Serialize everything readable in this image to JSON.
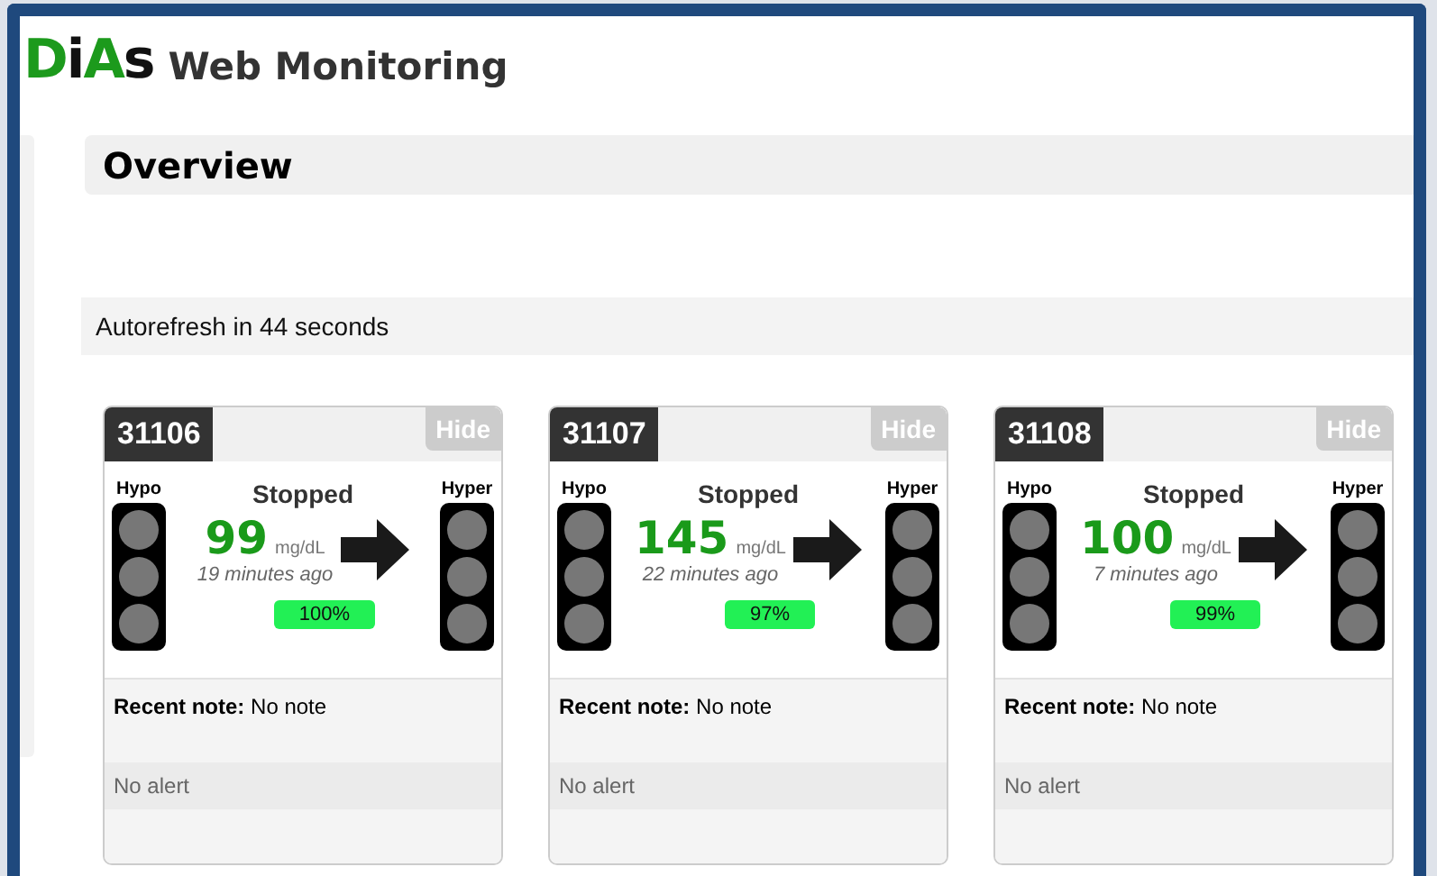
{
  "logo": [
    {
      "text": "D",
      "color": "#1c9a1c"
    },
    {
      "text": "i",
      "color": "#111111"
    },
    {
      "text": "A",
      "color": "#1c9a1c"
    },
    {
      "text": "s",
      "color": "#111111"
    }
  ],
  "app_title": "Web Monitoring",
  "page_title": "Overview",
  "autorefresh": "Autorefresh in 44 seconds",
  "patients": [
    {
      "id": "31106",
      "hide": "Hide",
      "hypo": "Hypo",
      "hyper": "Hyper",
      "status": "Stopped",
      "value": "99",
      "unit": "mg/dL",
      "ago": "19 minutes ago",
      "percent": "100%",
      "note": "**Recent note:** No note",
      "alert": "No alert"
    },
    {
      "id": "31107",
      "hide": "Hide",
      "hypo": "Hypo",
      "hyper": "Hyper",
      "status": "Stopped",
      "value": "145",
      "unit": "mg/dL",
      "ago": "22 minutes ago",
      "percent": "97%",
      "note": "**Recent note:** No note",
      "alert": "No alert"
    },
    {
      "id": "31108",
      "hide": "Hide",
      "hypo": "Hypo",
      "hyper": "Hyper",
      "status": "Stopped",
      "value": "100",
      "unit": "mg/dL",
      "ago": "7 minutes ago",
      "percent": "99%",
      "note": "**Recent note:** No note",
      "alert": "No alert"
    }
  ]
}
